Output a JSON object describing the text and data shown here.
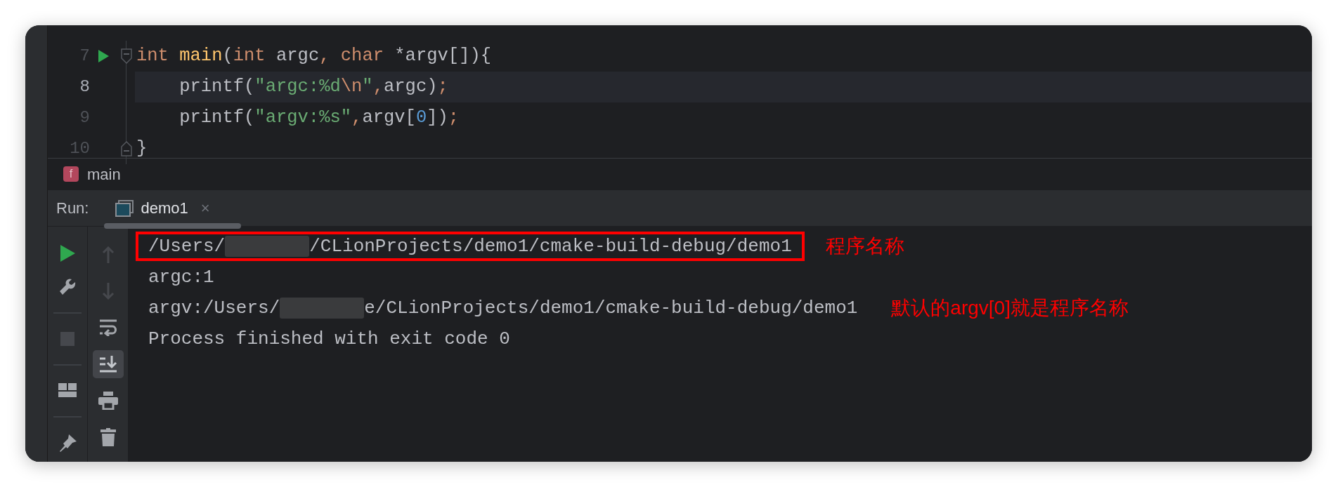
{
  "editor": {
    "lines": [
      {
        "number": "7",
        "current": false,
        "run_marker": true,
        "fold_open": true,
        "fold_close": false,
        "tokens": [
          {
            "text": "int ",
            "kind": "keyword"
          },
          {
            "text": "main",
            "kind": "function"
          },
          {
            "text": "(",
            "kind": "plain"
          },
          {
            "text": "int",
            "kind": "keyword"
          },
          {
            "text": " argc",
            "kind": "plain"
          },
          {
            "text": ", ",
            "kind": "punct"
          },
          {
            "text": "char",
            "kind": "keyword"
          },
          {
            "text": " *argv[]){",
            "kind": "plain"
          }
        ]
      },
      {
        "number": "8",
        "current": true,
        "run_marker": false,
        "fold_open": false,
        "fold_close": false,
        "tokens": [
          {
            "text": "    printf(",
            "kind": "plain"
          },
          {
            "text": "\"argc:%d",
            "kind": "string"
          },
          {
            "text": "\\n",
            "kind": "escape"
          },
          {
            "text": "\"",
            "kind": "string"
          },
          {
            "text": ",",
            "kind": "punct"
          },
          {
            "text": "argc)",
            "kind": "plain"
          },
          {
            "text": ";",
            "kind": "punct"
          }
        ]
      },
      {
        "number": "9",
        "current": false,
        "run_marker": false,
        "fold_open": false,
        "fold_close": false,
        "tokens": [
          {
            "text": "    printf(",
            "kind": "plain"
          },
          {
            "text": "\"argv:%s\"",
            "kind": "string"
          },
          {
            "text": ",",
            "kind": "punct"
          },
          {
            "text": "argv[",
            "kind": "plain"
          },
          {
            "text": "0",
            "kind": "number"
          },
          {
            "text": "])",
            "kind": "plain"
          },
          {
            "text": ";",
            "kind": "punct"
          }
        ]
      },
      {
        "number": "10",
        "current": false,
        "run_marker": false,
        "fold_open": false,
        "fold_close": true,
        "tokens": [
          {
            "text": "}",
            "kind": "plain"
          }
        ]
      }
    ]
  },
  "breadcrumb": {
    "badge": "f",
    "label": "main"
  },
  "run_panel": {
    "label": "Run:",
    "tabs": [
      {
        "label": "demo1",
        "selected": true,
        "close": "×"
      }
    ],
    "toolbar_main": [
      {
        "kind": "run",
        "disabled": false
      },
      {
        "kind": "wrench",
        "disabled": false
      },
      {
        "kind": "separator"
      },
      {
        "kind": "stop",
        "disabled": true
      },
      {
        "kind": "separator"
      },
      {
        "kind": "layout",
        "disabled": false
      },
      {
        "kind": "separator"
      },
      {
        "kind": "pin",
        "disabled": false
      }
    ],
    "toolbar_output": [
      {
        "kind": "up",
        "disabled": true,
        "selected": false
      },
      {
        "kind": "down",
        "disabled": true,
        "selected": false
      },
      {
        "kind": "wrap",
        "disabled": false,
        "selected": false
      },
      {
        "kind": "scroll_end",
        "disabled": false,
        "selected": true
      },
      {
        "kind": "print",
        "disabled": false,
        "selected": false
      },
      {
        "kind": "trash",
        "disabled": false,
        "selected": false
      }
    ],
    "output": [
      {
        "boxed": true,
        "note": "程序名称",
        "segments": [
          {
            "kind": "text",
            "text": "/Users/"
          },
          {
            "kind": "redacted"
          },
          {
            "kind": "text",
            "text": "/CLionProjects/demo1/cmake-build-debug/demo1"
          }
        ]
      },
      {
        "boxed": false,
        "segments": [
          {
            "kind": "text",
            "text": "argc:1"
          }
        ]
      },
      {
        "boxed": false,
        "note": "默认的argv[0]就是程序名称",
        "segments": [
          {
            "kind": "text",
            "text": "argv:/Users/"
          },
          {
            "kind": "redacted"
          },
          {
            "kind": "text",
            "text": "e/CLionProjects/demo1/cmake-build-debug/demo1"
          }
        ]
      },
      {
        "boxed": false,
        "segments": [
          {
            "kind": "text",
            "text": "Process finished with exit code 0"
          }
        ]
      }
    ]
  }
}
